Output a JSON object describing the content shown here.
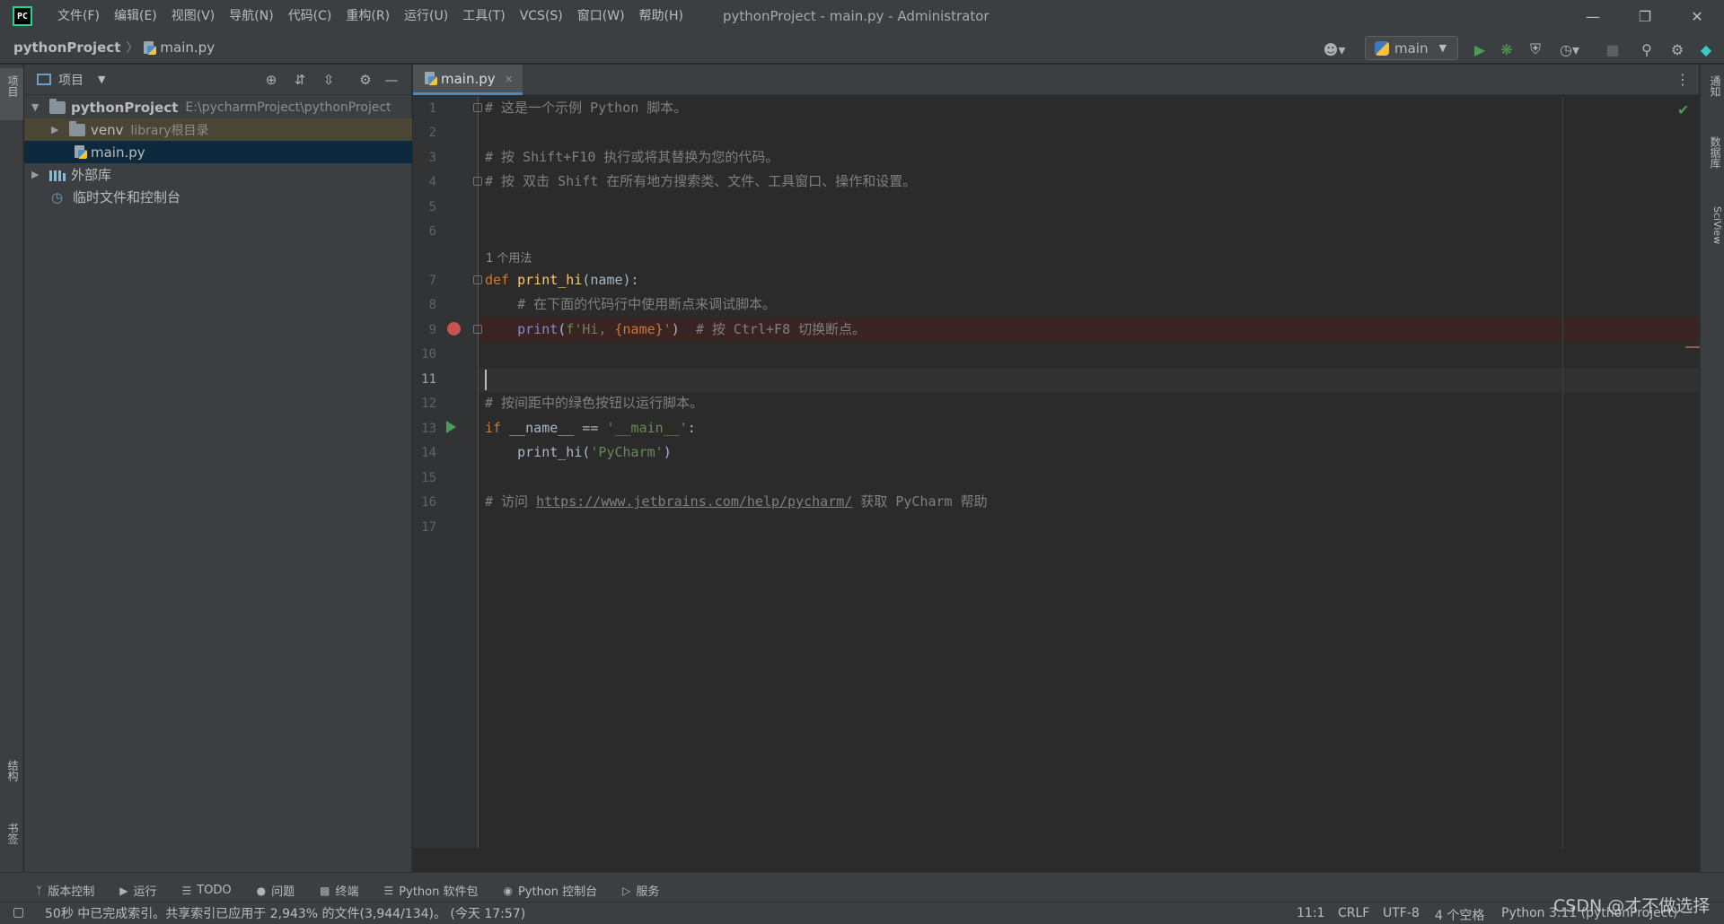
{
  "titlebar": {
    "menus": [
      "文件(F)",
      "编辑(E)",
      "视图(V)",
      "导航(N)",
      "代码(C)",
      "重构(R)",
      "运行(U)",
      "工具(T)",
      "VCS(S)",
      "窗口(W)",
      "帮助(H)"
    ],
    "window_title": "pythonProject - main.py - Administrator",
    "minimize": "—",
    "restore": "❐",
    "close": "✕"
  },
  "navbar": {
    "project": "pythonProject",
    "file": "main.py",
    "run_config": "main"
  },
  "left_stripe": {
    "project_label": "项目",
    "structure_label": "结构",
    "bookmarks_label": "书签"
  },
  "right_stripe": {
    "notifications_label": "通知",
    "database_label": "数据库",
    "sciview_label": "SciView"
  },
  "project_panel": {
    "title": "项目",
    "tree": {
      "root_name": "pythonProject",
      "root_path": "E:\\pycharmProject\\pythonProject",
      "venv_name": "venv",
      "venv_hint": "library根目录",
      "main_file": "main.py",
      "external_libs": "外部库",
      "scratches": "临时文件和控制台"
    }
  },
  "editor": {
    "tab_label": "main.py",
    "tab_close": "×",
    "usage_hint": "1 个用法",
    "line_numbers": [
      "1",
      "2",
      "3",
      "4",
      "5",
      "6",
      "7",
      "8",
      "9",
      "10",
      "11",
      "12",
      "13",
      "14",
      "15",
      "16",
      "17"
    ],
    "lines": {
      "l1": "# 这是一个示例 Python 脚本。",
      "l3": "# 按 Shift+F10 执行或将其替换为您的代码。",
      "l4": "# 按 双击 Shift 在所有地方搜索类、文件、工具窗口、操作和设置。",
      "l7_kw": "def ",
      "l7_fn": "print_hi",
      "l7_rest": "(name):",
      "l8": "    # 在下面的代码行中使用断点来调试脚本。",
      "l9_indent": "    ",
      "l9_builtin": "print",
      "l9_open": "(",
      "l9_str1": "f'Hi, ",
      "l9_interp": "{name}",
      "l9_str2": "'",
      "l9_close": ")  ",
      "l9_comment": "# 按 Ctrl+F8 切换断点。",
      "l12": "# 按间距中的绿色按钮以运行脚本。",
      "l13_kw": "if ",
      "l13_mid": "__name__ == ",
      "l13_str": "'__main__'",
      "l13_end": ":",
      "l14_call": "    print_hi(",
      "l14_str": "'PyCharm'",
      "l14_end": ")",
      "l16_pre": "# 访问 ",
      "l16_link": "https://www.jetbrains.com/help/pycharm/",
      "l16_post": " 获取 PyCharm 帮助"
    }
  },
  "bottom_tools": [
    "版本控制",
    "运行",
    "TODO",
    "问题",
    "终端",
    "Python 软件包",
    "Python 控制台",
    "服务"
  ],
  "statusbar": {
    "message": "50秒 中已完成索引。共享索引已应用于 2,943% 的文件(3,944/134)。 (今天 17:57)",
    "position": "11:1",
    "line_sep": "CRLF",
    "encoding": "UTF-8",
    "indent": "4 个空格",
    "interpreter": "Python 3.11 (pythonProject)"
  },
  "watermark": "CSDN @才不做选择",
  "colors": {
    "accent": "#4a88c7",
    "breakpoint": "#c75450",
    "run": "#499c54",
    "background": "#2b2b2b"
  }
}
